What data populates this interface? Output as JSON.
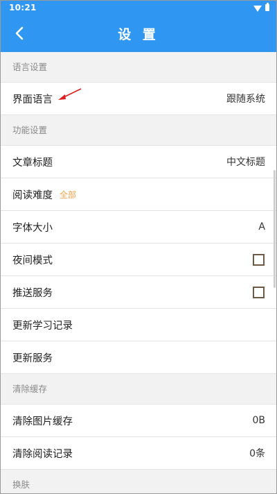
{
  "status": {
    "time": "10:21"
  },
  "header": {
    "title": "设 置"
  },
  "sections": {
    "language": {
      "title": "语言设置"
    },
    "function": {
      "title": "功能设置"
    },
    "cache": {
      "title": "清除缓存"
    },
    "skin": {
      "title": "换肤"
    }
  },
  "rows": {
    "ui_language": {
      "label": "界面语言",
      "value": "跟随系统"
    },
    "article_title": {
      "label": "文章标题",
      "value": "中文标题"
    },
    "reading_difficulty": {
      "label": "阅读难度",
      "tag": "全部"
    },
    "font_size": {
      "label": "字体大小",
      "value": "A"
    },
    "night_mode": {
      "label": "夜间模式"
    },
    "push_service": {
      "label": "推送服务"
    },
    "update_study": {
      "label": "更新学习记录"
    },
    "update_service": {
      "label": "更新服务"
    },
    "clear_image_cache": {
      "label": "清除图片缓存",
      "value": "0B"
    },
    "clear_reading_history": {
      "label": "清除阅读记录",
      "value": "0条"
    }
  },
  "colors": {
    "header": "#2f97f2",
    "tag": "#f0a24a",
    "annotation_arrow": "#e02020"
  }
}
